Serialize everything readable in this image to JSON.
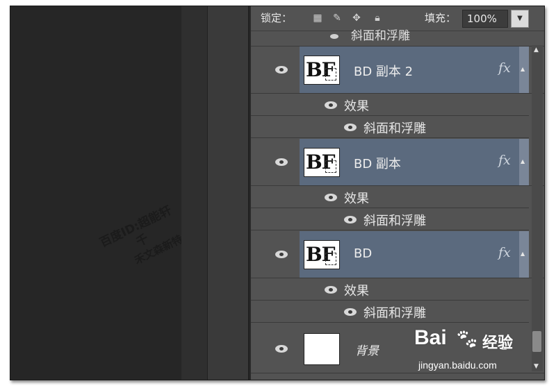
{
  "options_bar": {
    "lock_label": "锁定：",
    "fill_label": "填充：",
    "fill_value": "100%"
  },
  "partial_row": {
    "label": "斜面和浮雕"
  },
  "layers": [
    {
      "name": "BD 副本 2",
      "fx": "fx",
      "thumb_text": "BF",
      "effects_label": "效果",
      "effect_name": "斜面和浮雕"
    },
    {
      "name": "BD 副本",
      "fx": "fx",
      "thumb_text": "BF",
      "effects_label": "效果",
      "effect_name": "斜面和浮雕"
    },
    {
      "name": "BD",
      "fx": "fx",
      "thumb_text": "BF",
      "effects_label": "效果",
      "effect_name": "斜面和浮雕"
    }
  ],
  "background_layer": {
    "name": "背景"
  },
  "watermark": {
    "line1": "百度ID:超能轩千",
    "line2": "禾文森新特"
  },
  "baidu": {
    "word": "Bai",
    "cn": "经验",
    "url": "jingyan.baidu.com"
  }
}
